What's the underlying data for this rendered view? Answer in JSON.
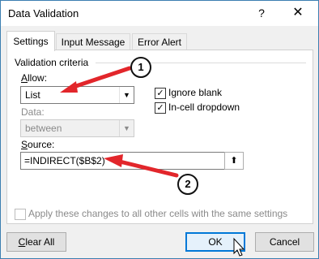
{
  "window": {
    "title": "Data Validation",
    "help": "?",
    "close": "✕"
  },
  "tabs": [
    {
      "label": "Settings",
      "active": true
    },
    {
      "label": "Input Message",
      "active": false
    },
    {
      "label": "Error Alert",
      "active": false
    }
  ],
  "criteria": {
    "group_label": "Validation criteria",
    "allow_label": "Allow:",
    "allow_value": "List",
    "data_label": "Data:",
    "data_value": "between",
    "ignore_blank_label": "Ignore blank",
    "ignore_blank_checked": true,
    "in_cell_label": "In-cell dropdown",
    "in_cell_checked": true,
    "source_label": "Source:",
    "source_value": "=INDIRECT($B$2)"
  },
  "apply_all": {
    "label": "Apply these changes to all other cells with the same settings",
    "checked": false
  },
  "buttons": {
    "clear_all": "Clear All",
    "ok": "OK",
    "cancel": "Cancel"
  },
  "callouts": {
    "one": "1",
    "two": "2"
  },
  "colors": {
    "accent": "#0078d7",
    "arrow": "#e2262b"
  }
}
